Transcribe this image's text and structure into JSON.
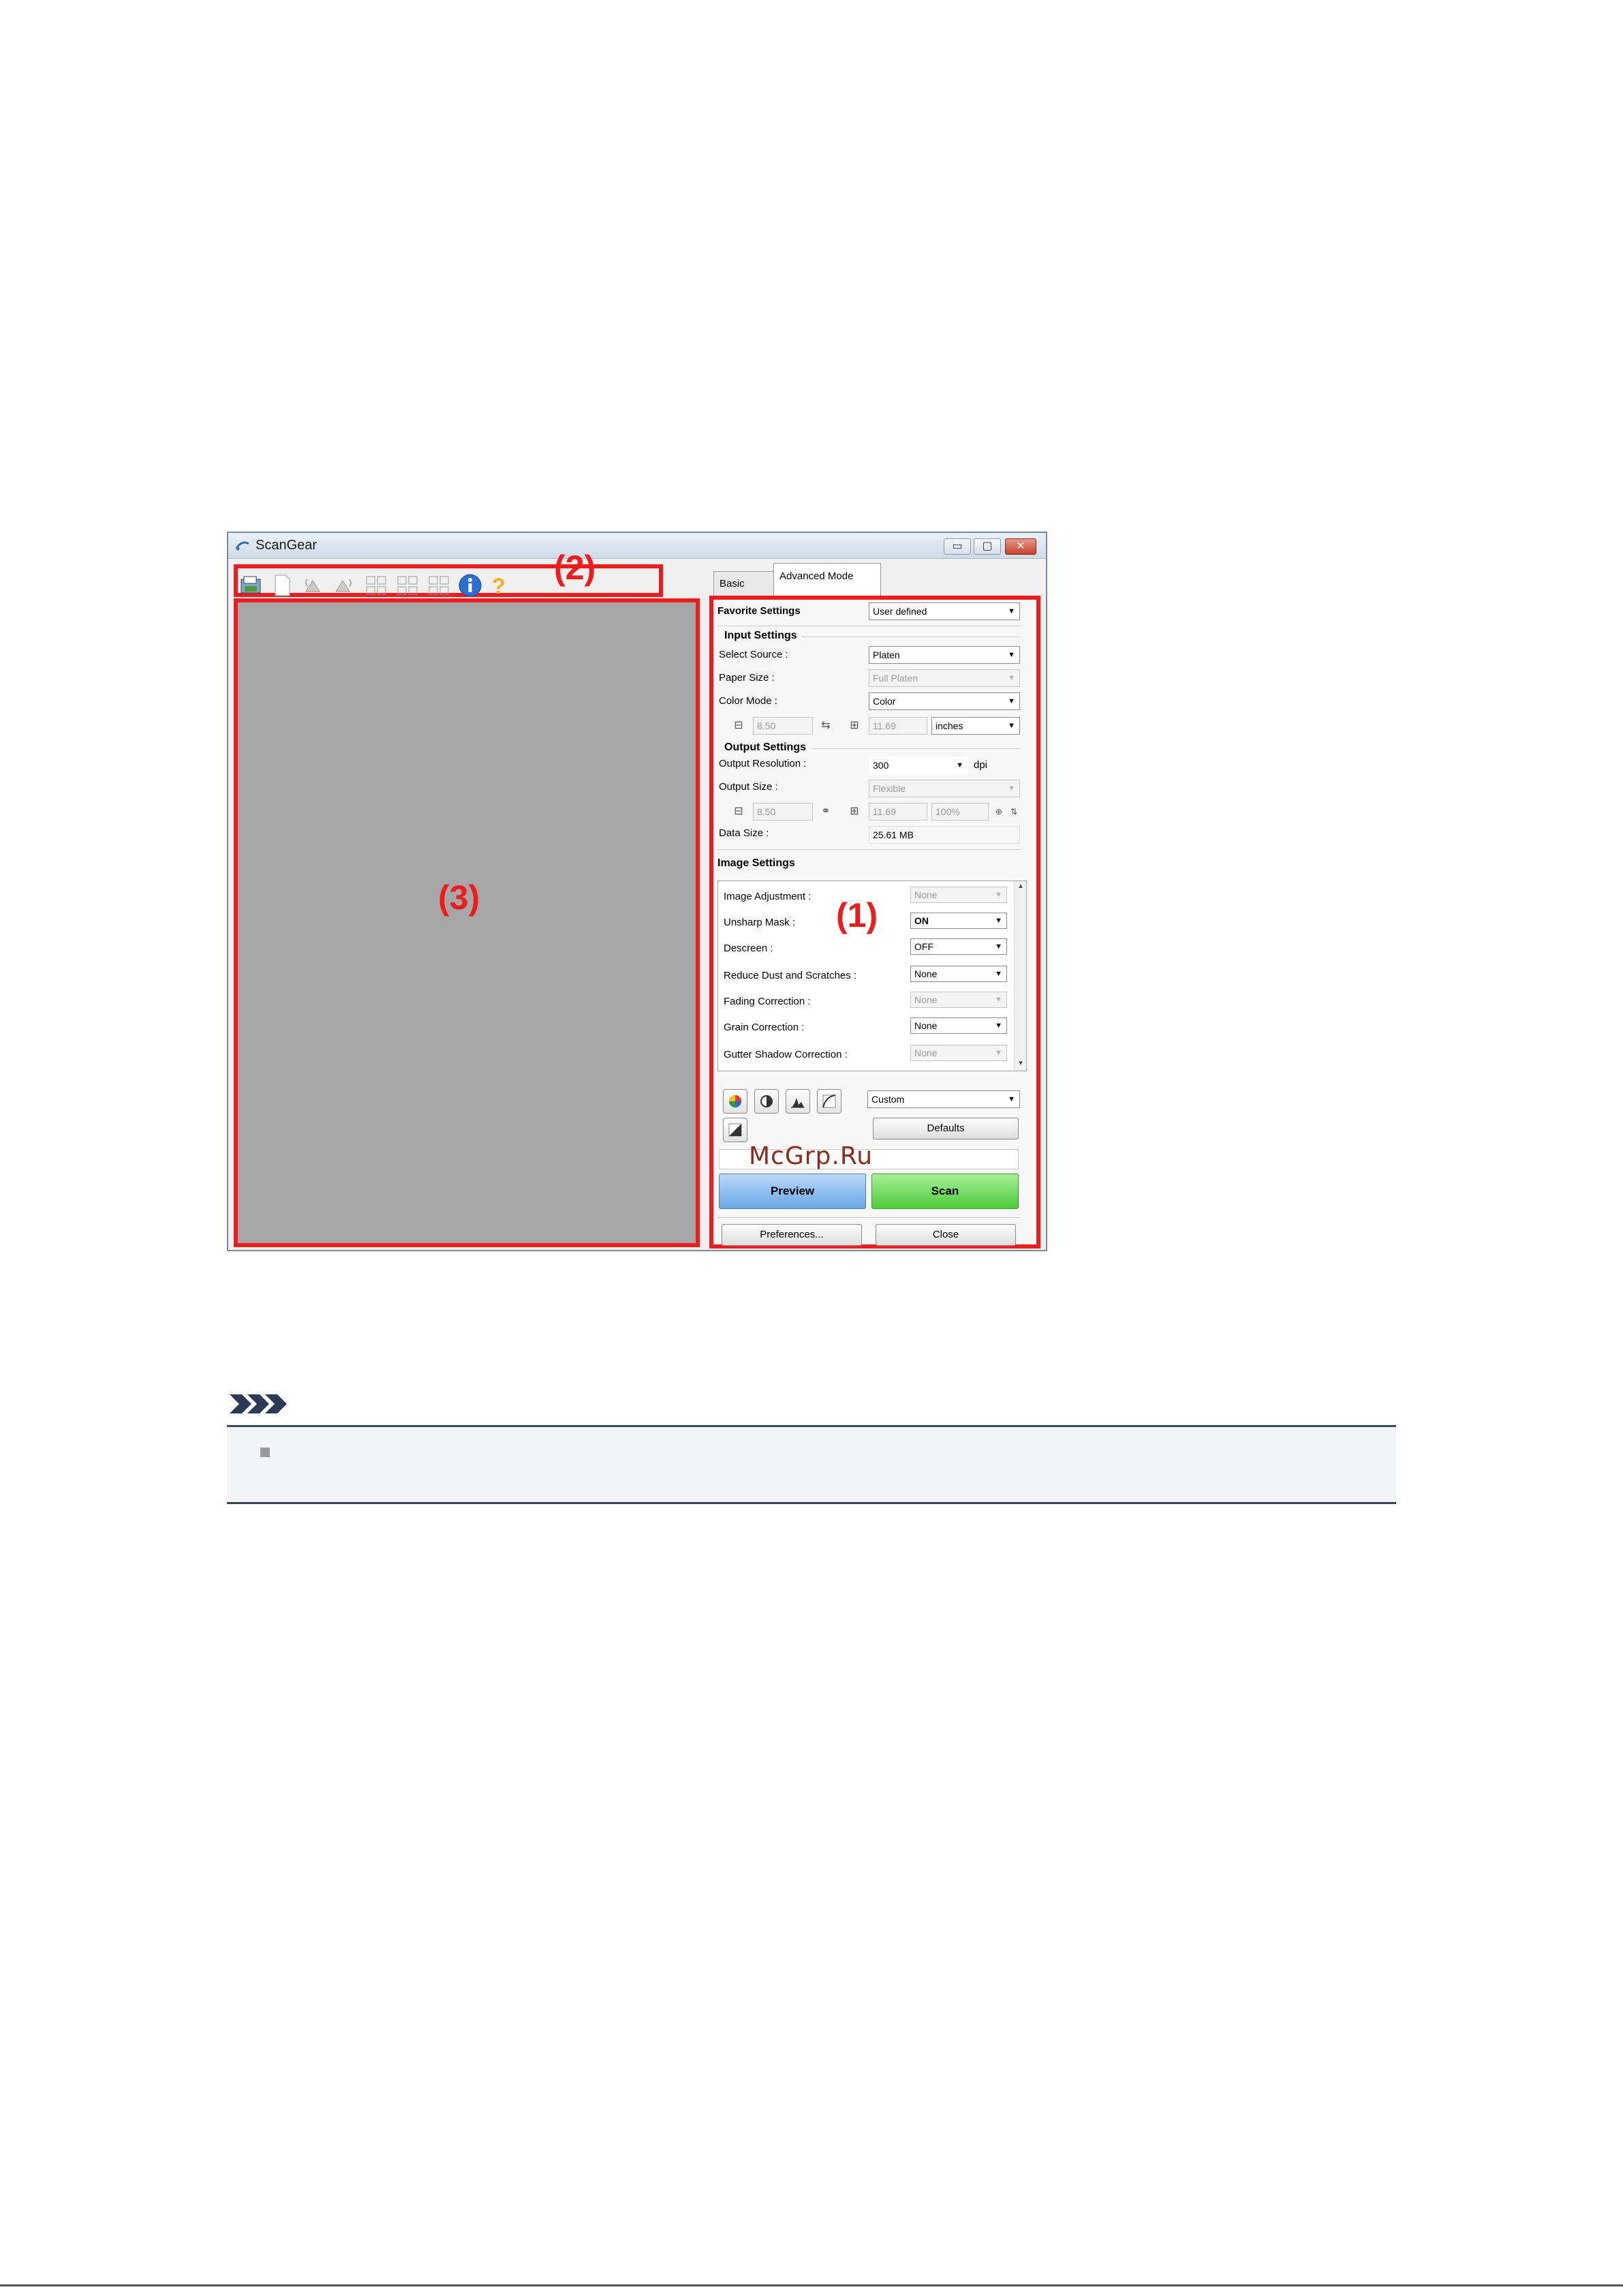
{
  "window": {
    "title": "ScanGear",
    "controls": {
      "minimize": "▭",
      "maximize": "▢",
      "close": "✕"
    }
  },
  "tabs": {
    "basic": "Basic Mode",
    "advanced": "Advanced Mode"
  },
  "callouts": {
    "one": "(1)",
    "two": "(2)",
    "three": "(3)"
  },
  "favorite": {
    "label": "Favorite Settings",
    "value": "User defined"
  },
  "input_settings": {
    "title": "Input Settings",
    "select_source_label": "Select Source :",
    "select_source_value": "Platen",
    "paper_size_label": "Paper Size :",
    "paper_size_value": "Full Platen",
    "color_mode_label": "Color Mode :",
    "color_mode_value": "Color",
    "width": "8.50",
    "height": "11.69",
    "unit": "inches"
  },
  "output_settings": {
    "title": "Output Settings",
    "resolution_label": "Output Resolution :",
    "resolution_value": "300",
    "resolution_unit": "dpi",
    "size_label": "Output Size :",
    "size_value": "Flexible",
    "width": "8.50",
    "height": "11.69",
    "scale": "100%",
    "data_size_label": "Data Size :",
    "data_size_value": "25.61 MB"
  },
  "image_settings": {
    "title": "Image Settings",
    "rows": [
      {
        "label": "Image Adjustment :",
        "value": "None",
        "disabled": true
      },
      {
        "label": "Unsharp Mask :",
        "value": "ON",
        "disabled": false
      },
      {
        "label": "Descreen :",
        "value": "OFF",
        "disabled": false
      },
      {
        "label": "Reduce Dust and Scratches :",
        "value": "None",
        "disabled": false
      },
      {
        "label": "Fading Correction :",
        "value": "None",
        "disabled": true
      },
      {
        "label": "Grain Correction :",
        "value": "None",
        "disabled": false
      },
      {
        "label": "Gutter Shadow Correction :",
        "value": "None",
        "disabled": true
      }
    ]
  },
  "tone": {
    "preset": "Custom",
    "defaults_label": "Defaults"
  },
  "buttons": {
    "preview": "Preview",
    "scan": "Scan",
    "preferences": "Preferences...",
    "close": "Close"
  },
  "watermark": "McGrp.Ru",
  "colors": {
    "highlight": "#ee1c1c",
    "preview_bg": "#a6a6a6",
    "scan_green": "#4ccc3a",
    "preview_blue": "#69a7e6"
  }
}
